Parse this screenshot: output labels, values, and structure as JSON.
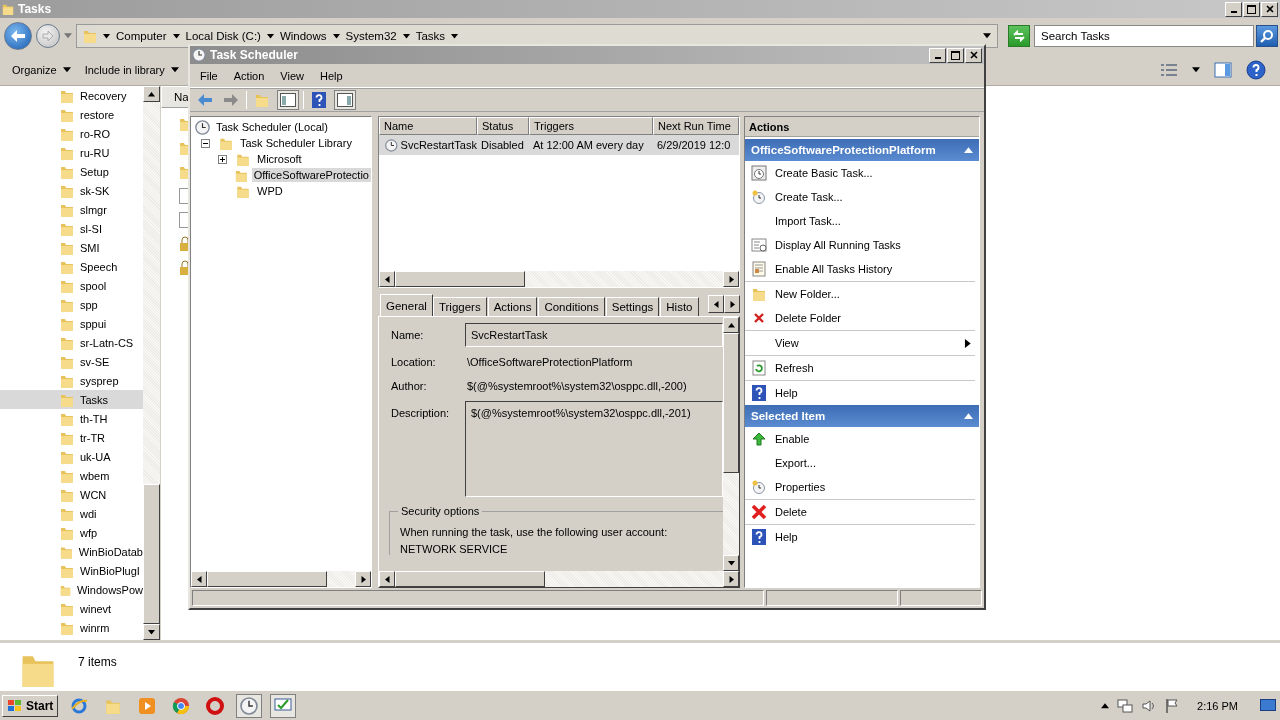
{
  "explorer": {
    "title": "Tasks",
    "breadcrumbs": [
      "Computer",
      "Local Disk (C:)",
      "Windows",
      "System32",
      "Tasks"
    ],
    "search": {
      "placeholder": "Search Tasks"
    },
    "toolbar": [
      "Organize",
      "Include in library"
    ],
    "folders": [
      {
        "name": "Recovery",
        "selected": false
      },
      {
        "name": "restore",
        "selected": false
      },
      {
        "name": "ro-RO",
        "selected": false
      },
      {
        "name": "ru-RU",
        "selected": false
      },
      {
        "name": "Setup",
        "selected": false
      },
      {
        "name": "sk-SK",
        "selected": false
      },
      {
        "name": "slmgr",
        "selected": false
      },
      {
        "name": "sl-SI",
        "selected": false
      },
      {
        "name": "SMI",
        "selected": false
      },
      {
        "name": "Speech",
        "selected": false
      },
      {
        "name": "spool",
        "selected": false
      },
      {
        "name": "spp",
        "selected": false
      },
      {
        "name": "sppui",
        "selected": false
      },
      {
        "name": "sr-Latn-CS",
        "selected": false
      },
      {
        "name": "sv-SE",
        "selected": false
      },
      {
        "name": "sysprep",
        "selected": false
      },
      {
        "name": "Tasks",
        "selected": true
      },
      {
        "name": "th-TH",
        "selected": false
      },
      {
        "name": "tr-TR",
        "selected": false
      },
      {
        "name": "uk-UA",
        "selected": false
      },
      {
        "name": "wbem",
        "selected": false
      },
      {
        "name": "WCN",
        "selected": false
      },
      {
        "name": "wdi",
        "selected": false
      },
      {
        "name": "wfp",
        "selected": false
      },
      {
        "name": "WinBioDatab",
        "selected": false
      },
      {
        "name": "WinBioPlugI",
        "selected": false
      },
      {
        "name": "WindowsPow",
        "selected": false
      },
      {
        "name": "winevt",
        "selected": false
      },
      {
        "name": "winrm",
        "selected": false
      }
    ],
    "content_header": "Na",
    "status": "7 items"
  },
  "scheduler": {
    "title": "Task Scheduler",
    "menu": [
      "File",
      "Action",
      "View",
      "Help"
    ],
    "tree": [
      {
        "label": "Task Scheduler (Local)",
        "kind": "root",
        "selected": false,
        "children": [
          {
            "label": "Task Scheduler Library",
            "kind": "library",
            "expanded": true,
            "selected": false,
            "children": [
              {
                "label": "Microsoft",
                "kind": "folder",
                "expanded": false,
                "selected": false
              },
              {
                "label": "OfficeSoftwareProtectio",
                "kind": "folder",
                "selected": true
              },
              {
                "label": "WPD",
                "kind": "folder",
                "selected": false
              }
            ]
          }
        ]
      }
    ],
    "table": {
      "columns": [
        "Name",
        "Status",
        "Triggers",
        "Next Run Time"
      ],
      "rows": [
        {
          "cells": [
            "SvcRestartTask",
            "Disabled",
            "At 12:00 AM every day",
            "6/29/2019 12:0"
          ],
          "selected": true
        }
      ]
    },
    "tabs": [
      {
        "label": "General",
        "selected": true
      },
      {
        "label": "Triggers",
        "selected": false
      },
      {
        "label": "Actions",
        "selected": false
      },
      {
        "label": "Conditions",
        "selected": false
      },
      {
        "label": "Settings",
        "selected": false
      },
      {
        "label": "Histo",
        "selected": false
      }
    ],
    "fields": [
      {
        "label": "Name:",
        "value": "SvcRestartTask",
        "kind": "input"
      },
      {
        "label": "Location:",
        "value": "\\OfficeSoftwareProtectionPlatform",
        "kind": "text"
      },
      {
        "label": "Author:",
        "value": "$(@%systemroot%\\system32\\osppc.dll,-200)",
        "kind": "text"
      },
      {
        "label": "Description:",
        "value": "$(@%systemroot%\\system32\\osppc.dll,-201)",
        "kind": "textarea"
      }
    ],
    "security": {
      "title": "Security options",
      "text": "When running the task, use the following user account:",
      "account": "NETWORK SERVICE"
    },
    "actions_title": "Actions",
    "sections": [
      {
        "title": "OfficeSoftwareProtectionPlatform",
        "groups": [
          [
            {
              "label": "Create Basic Task...",
              "kind": "wizard"
            },
            {
              "label": "Create Task...",
              "kind": "task"
            },
            {
              "label": "Import Task...",
              "kind": "plain"
            },
            {
              "label": "Display All Running Tasks",
              "kind": "running"
            },
            {
              "label": "Enable All Tasks History",
              "kind": "history"
            }
          ],
          [
            {
              "label": "New Folder...",
              "kind": "folder"
            },
            {
              "label": "Delete Folder",
              "kind": "remove"
            }
          ],
          [
            {
              "label": "View",
              "kind": "menu"
            }
          ],
          [
            {
              "label": "Refresh",
              "kind": "refresh"
            }
          ],
          [
            {
              "label": "Help",
              "kind": "help"
            }
          ]
        ]
      },
      {
        "title": "Selected Item",
        "groups": [
          [
            {
              "label": "Enable",
              "kind": "enable"
            },
            {
              "label": "Export...",
              "kind": "plain"
            },
            {
              "label": "Properties",
              "kind": "task"
            }
          ],
          [
            {
              "label": "Delete",
              "kind": "delete"
            }
          ],
          [
            {
              "label": "Help",
              "kind": "help"
            }
          ]
        ]
      }
    ]
  },
  "taskbar": {
    "start": "Start",
    "clock": "2:16 PM"
  }
}
